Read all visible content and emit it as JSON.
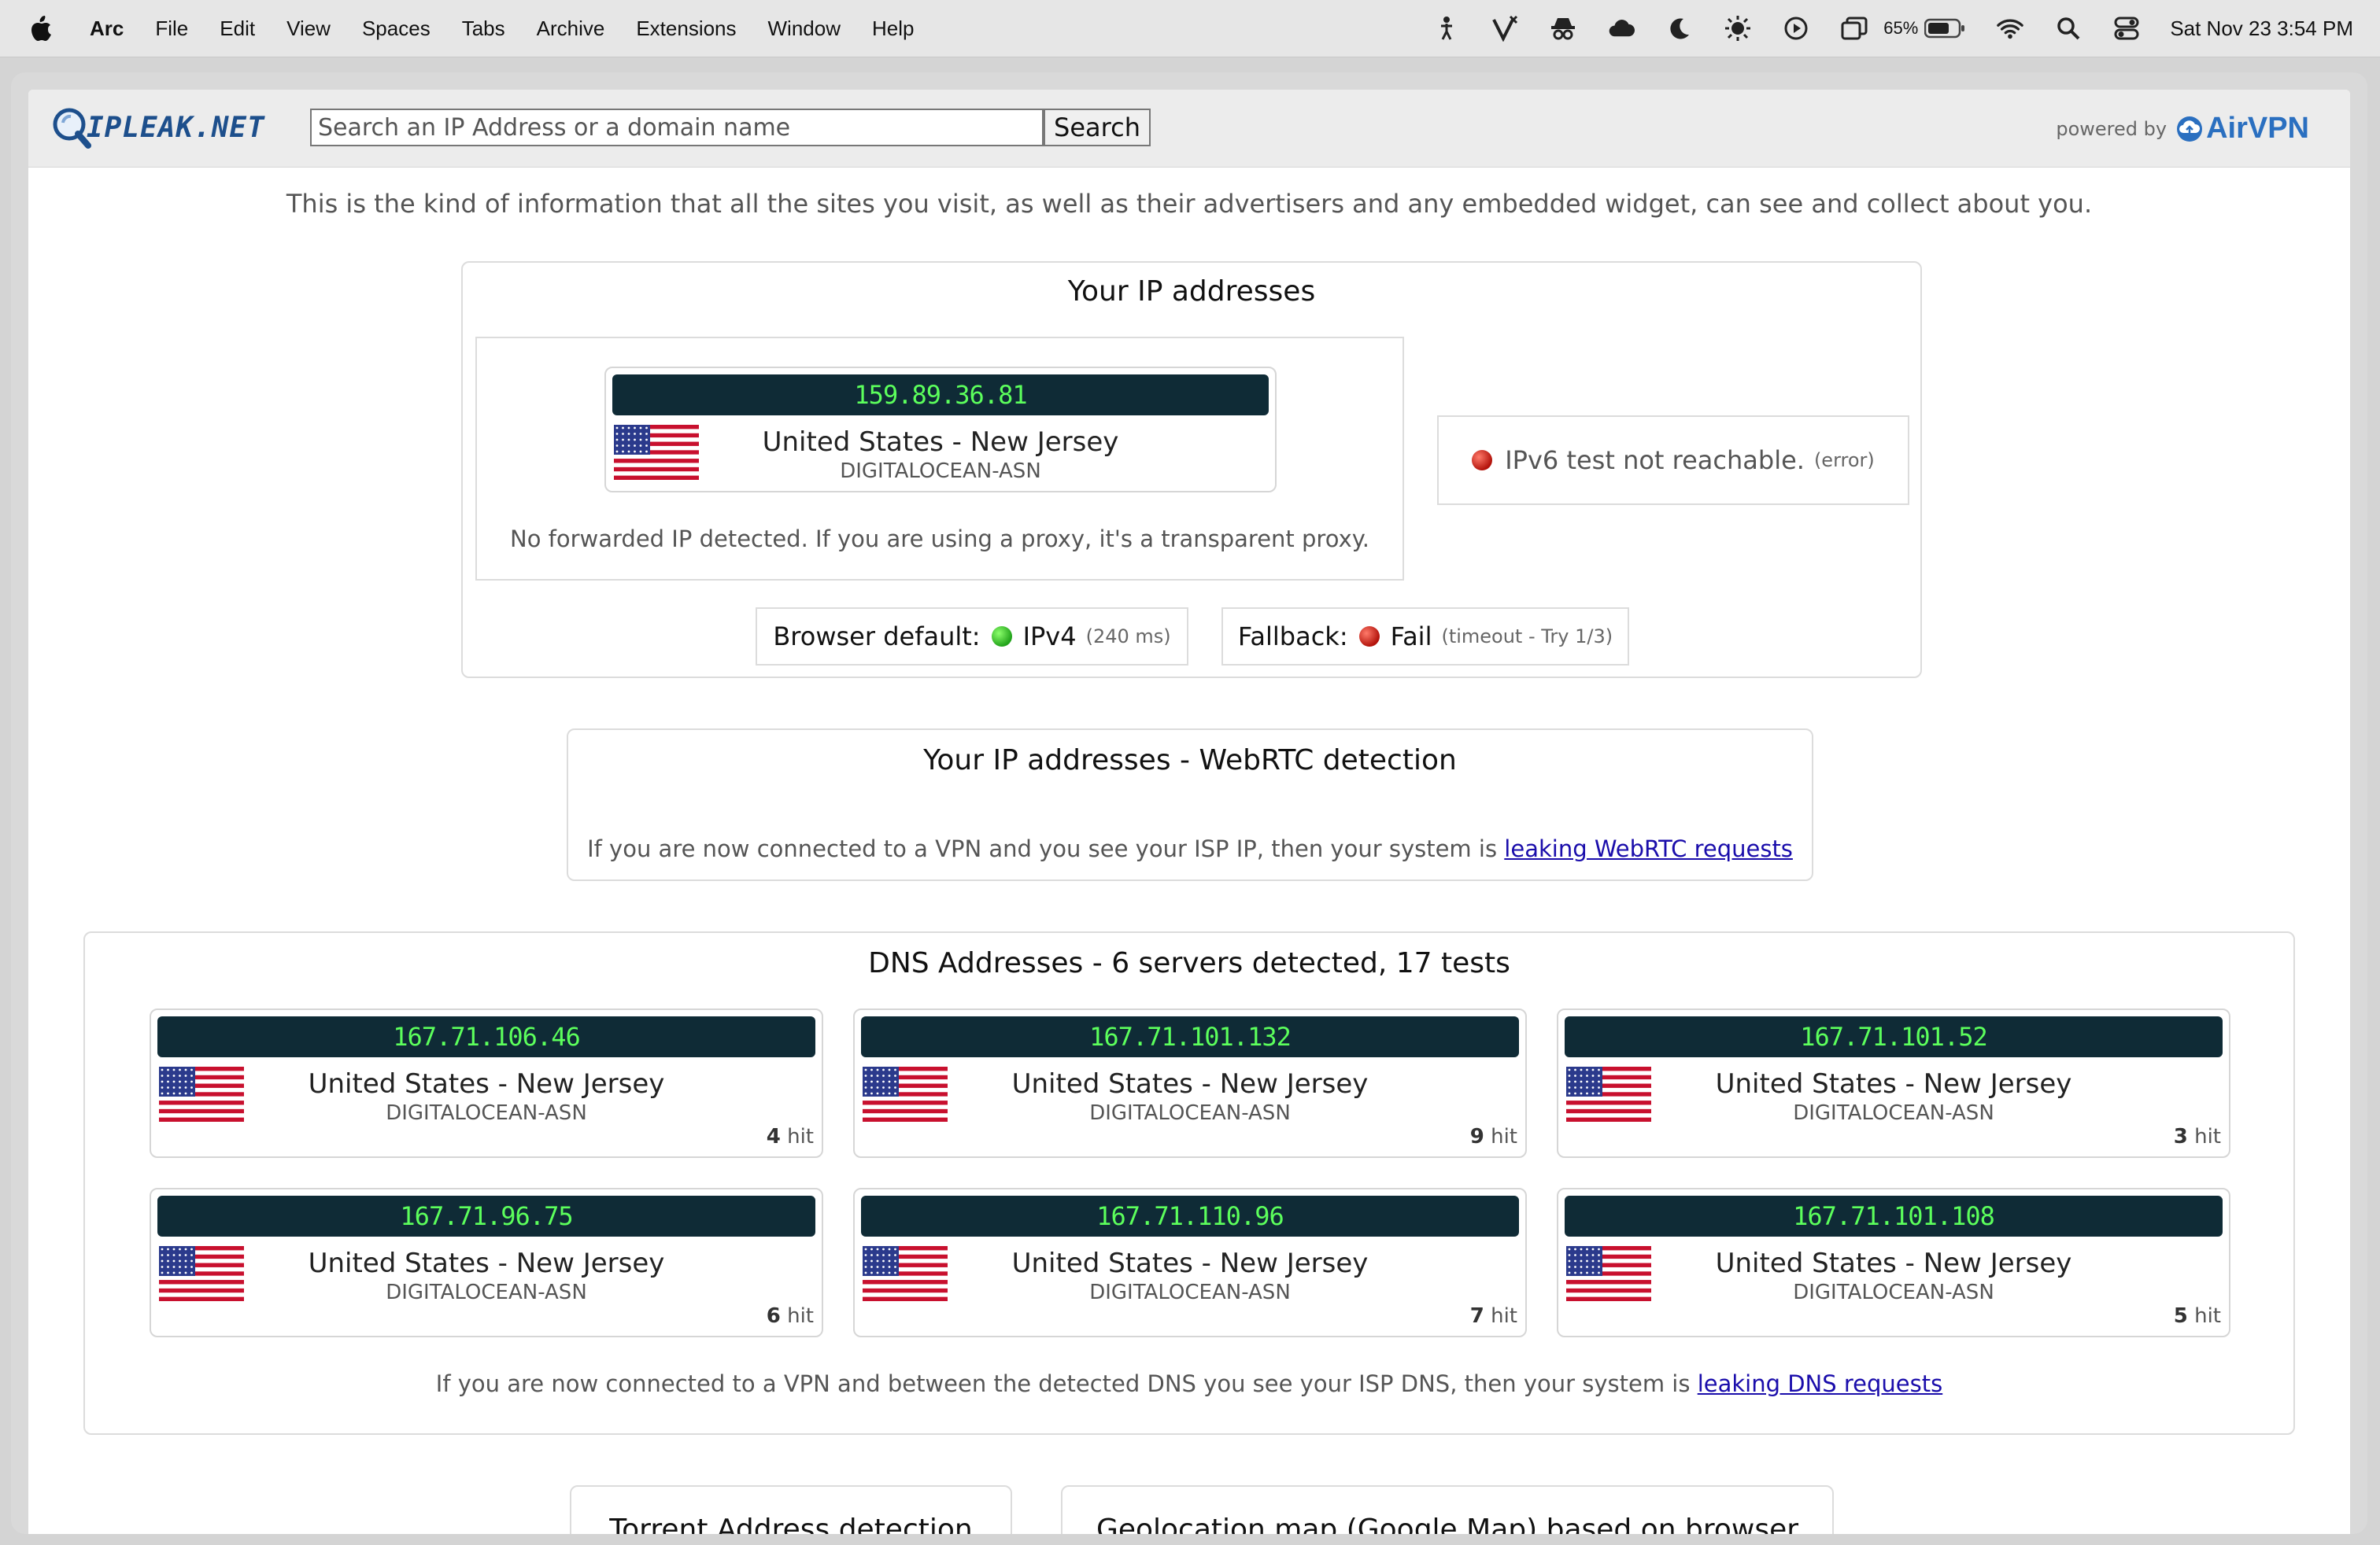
{
  "menubar": {
    "items": [
      "Arc",
      "File",
      "Edit",
      "View",
      "Spaces",
      "Tabs",
      "Archive",
      "Extensions",
      "Window",
      "Help"
    ],
    "battery": "65%",
    "clock": "Sat Nov 23  3:54 PM"
  },
  "header": {
    "logo_text": "IPLEAK.NET",
    "search_placeholder": "Search an IP Address or a domain name",
    "search_button": "Search",
    "powered_by": "powered by",
    "brand": "AirVPN"
  },
  "intro": "This is the kind of information that all the sites you visit, as well as their advertisers and any embedded widget, can see and collect about you.",
  "ip_section": {
    "title": "Your IP addresses",
    "ipv4": {
      "ip": "159.89.36.81",
      "location": "United States - New Jersey",
      "asn": "DIGITALOCEAN-ASN"
    },
    "forwarded_note": "No forwarded IP detected. If you are using a proxy, it's a transparent proxy.",
    "ipv6_text": "IPv6 test not reachable.",
    "ipv6_status": "(error)",
    "browser_default_label": "Browser default:",
    "browser_default_value": "IPv4",
    "browser_default_time": "(240 ms)",
    "fallback_label": "Fallback:",
    "fallback_value": "Fail",
    "fallback_note": "(timeout - Try 1/3)"
  },
  "webrtc": {
    "title": "Your IP addresses - WebRTC detection",
    "note": "If you are now connected to a VPN and you see your ISP IP, then your system is",
    "link": "leaking WebRTC requests"
  },
  "dns": {
    "title": "DNS Addresses - 6 servers detected, 17 tests",
    "hit_label": "hit",
    "servers": [
      {
        "ip": "167.71.106.46",
        "location": "United States - New Jersey",
        "asn": "DIGITALOCEAN-ASN",
        "hits": "4"
      },
      {
        "ip": "167.71.101.132",
        "location": "United States - New Jersey",
        "asn": "DIGITALOCEAN-ASN",
        "hits": "9"
      },
      {
        "ip": "167.71.101.52",
        "location": "United States - New Jersey",
        "asn": "DIGITALOCEAN-ASN",
        "hits": "3"
      },
      {
        "ip": "167.71.96.75",
        "location": "United States - New Jersey",
        "asn": "DIGITALOCEAN-ASN",
        "hits": "6"
      },
      {
        "ip": "167.71.110.96",
        "location": "United States - New Jersey",
        "asn": "DIGITALOCEAN-ASN",
        "hits": "7"
      },
      {
        "ip": "167.71.101.108",
        "location": "United States - New Jersey",
        "asn": "DIGITALOCEAN-ASN",
        "hits": "5"
      }
    ],
    "note": "If you are now connected to a VPN and between the detected DNS you see your ISP DNS, then your system is",
    "link": "leaking DNS requests"
  },
  "bottom_sections": {
    "torrent_title": "Torrent Address detection",
    "geo_title": "Geolocation map (Google Map) based on browser"
  },
  "colors": {
    "ip_bar_bg": "#0f2b36",
    "ip_text": "#5cff5c",
    "brand_blue": "#2a6fc0",
    "link": "#1a0dab"
  }
}
